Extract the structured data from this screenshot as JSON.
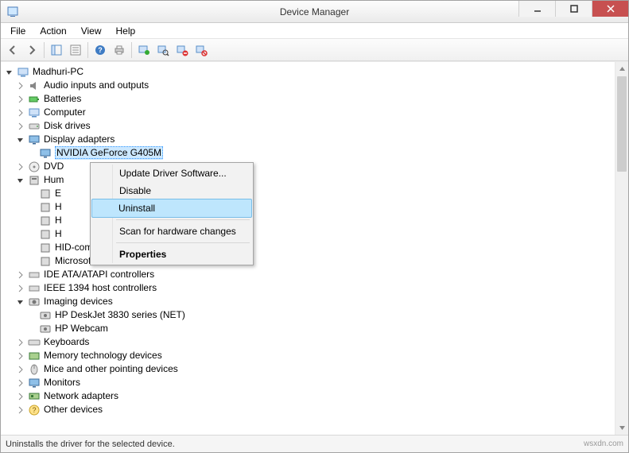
{
  "window": {
    "title": "Device Manager"
  },
  "menubar": {
    "file": "File",
    "action": "Action",
    "view": "View",
    "help": "Help"
  },
  "toolbar": {
    "back": "Back",
    "forward": "Forward",
    "show_hide_tree": "Show/Hide Console Tree",
    "properties": "Properties",
    "help": "Help",
    "print": "Print",
    "update": "Update Driver Software",
    "scan": "Scan for hardware changes",
    "disable": "Disable",
    "uninstall": "Uninstall"
  },
  "tree": {
    "root": "Madhuri-PC",
    "audio": "Audio inputs and outputs",
    "batteries": "Batteries",
    "computer": "Computer",
    "disk": "Disk drives",
    "display": "Display adapters",
    "display_children": {
      "nvidia": "NVIDIA GeForce G405M"
    },
    "dvd": "DVD",
    "hid": "Hum",
    "hid_children": {
      "h0": "E",
      "h1": "H",
      "h2": "H",
      "h3": "H",
      "h4": "HID-compliant vendor-defined device",
      "h5": "Microsoft eHome Infrared Transceiver"
    },
    "ide": "IDE ATA/ATAPI controllers",
    "ieee": "IEEE 1394 host controllers",
    "imaging": "Imaging devices",
    "imaging_children": {
      "deskjet": "HP DeskJet 3830 series (NET)",
      "webcam": "HP Webcam"
    },
    "keyboards": "Keyboards",
    "memory": "Memory technology devices",
    "mice": "Mice and other pointing devices",
    "monitors": "Monitors",
    "network": "Network adapters",
    "other": "Other devices"
  },
  "context_menu": {
    "update": "Update Driver Software...",
    "disable": "Disable",
    "uninstall": "Uninstall",
    "scan": "Scan for hardware changes",
    "properties": "Properties"
  },
  "statusbar": {
    "text": "Uninstalls the driver for the selected device."
  },
  "watermark": "wsxdn.com"
}
